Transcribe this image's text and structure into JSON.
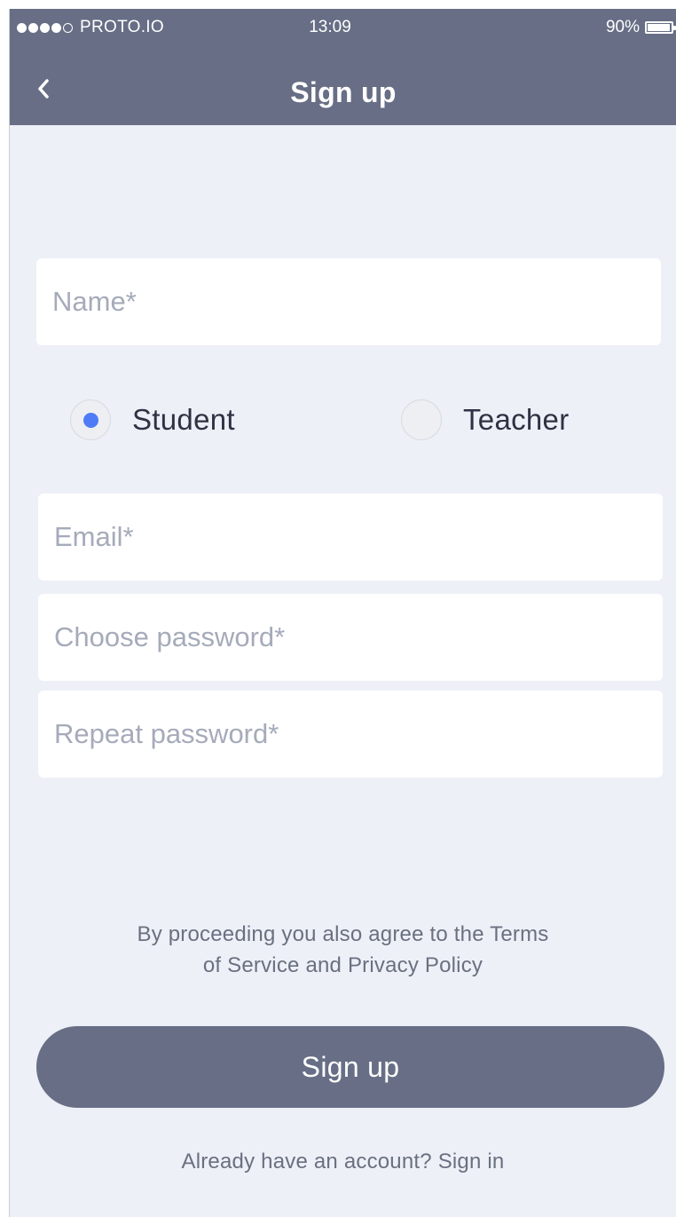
{
  "status_bar": {
    "carrier": "PROTO.IO",
    "time": "13:09",
    "battery_percent": "90%",
    "battery_level": 0.9,
    "signal_icon": "signal-dots-icon"
  },
  "nav": {
    "back_icon": "chevron-left-icon",
    "title": "Sign up"
  },
  "form": {
    "name_placeholder": "Name*",
    "role": {
      "options": [
        "Student",
        "Teacher"
      ],
      "selected": "Student"
    },
    "email_placeholder": "Email*",
    "password_placeholder": "Choose password*",
    "repeat_password_placeholder": "Repeat password*"
  },
  "terms": {
    "line1": "By proceeding you also agree to the Terms",
    "line2": "of Service and Privacy Policy"
  },
  "signup_button_label": "Sign up",
  "signin_link": "Already have an account? Sign in",
  "colors": {
    "header": "#676e85",
    "background": "#edf0f7",
    "accent": "#4f7cf6",
    "field": "#ffffff"
  }
}
